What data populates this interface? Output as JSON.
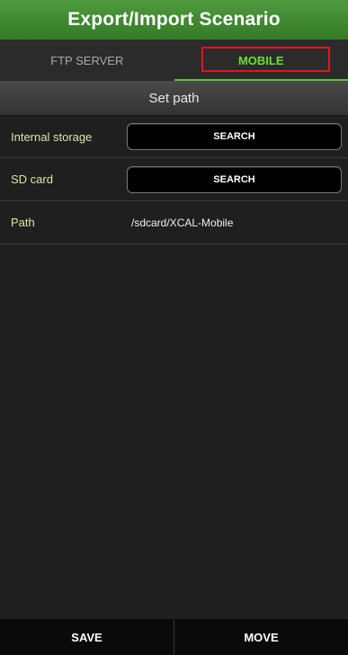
{
  "header": {
    "title": "Export/Import Scenario"
  },
  "tabs": [
    {
      "label": "FTP SERVER",
      "selected": false
    },
    {
      "label": "MOBILE",
      "selected": true
    }
  ],
  "section": {
    "title": "Set path"
  },
  "rows": {
    "internal_storage": {
      "label": "Internal storage",
      "button_label": "SEARCH"
    },
    "sd_card": {
      "label": "SD card",
      "button_label": "SEARCH"
    },
    "path": {
      "label": "Path",
      "value": "/sdcard/XCAL-Mobile"
    }
  },
  "footer": {
    "save_label": "SAVE",
    "move_label": "MOVE"
  },
  "colors": {
    "title_bar": "#3f8730",
    "active_tab_text": "#66e03a",
    "highlight_box": "#e5141b",
    "row_label": "#d9e7a6"
  }
}
